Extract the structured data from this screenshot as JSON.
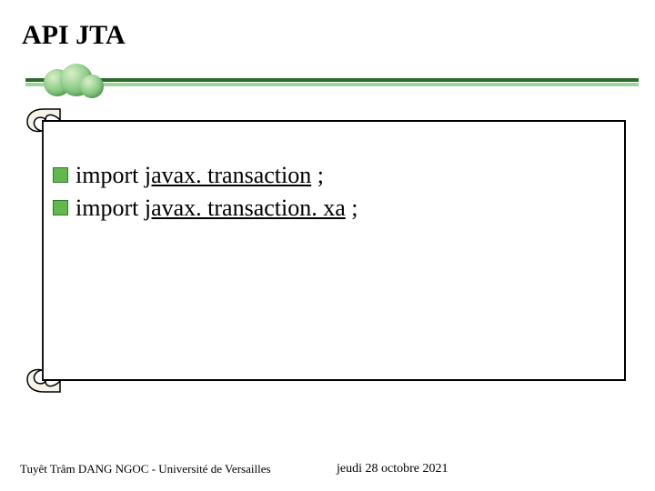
{
  "title": "API JTA",
  "bullets": [
    {
      "plain": "import ",
      "underlined": "javax. transaction",
      "tail": " ;"
    },
    {
      "plain": "import ",
      "underlined": "javax. transaction. xa",
      "tail": " ;"
    }
  ],
  "footer": {
    "left": "Tuyêt Trâm DANG NGOC - Université de Versailles",
    "right": "jeudi 28 octobre 2021"
  },
  "colors": {
    "bullet_fill": "#63b84a",
    "line_dark": "#2a6a2a",
    "line_light": "#9cd49c"
  }
}
